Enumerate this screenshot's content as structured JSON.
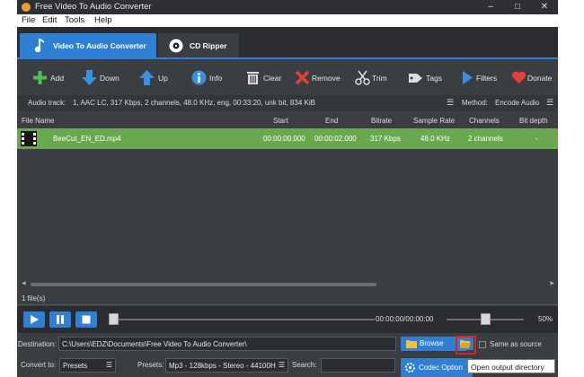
{
  "window": {
    "title": "Free Video To Audio Converter",
    "controls": [
      "–",
      "□",
      "✕"
    ]
  },
  "menu": [
    "File",
    "Edit",
    "Tools",
    "Help"
  ],
  "tabs": [
    {
      "label": "Video To Audio Converter",
      "icon": "music-note-icon",
      "active": true
    },
    {
      "label": "CD Ripper",
      "icon": "cd-icon",
      "active": false
    }
  ],
  "toolbar": {
    "add": "Add",
    "down": "Down",
    "up": "Up",
    "info": "Info",
    "clear": "Clear",
    "remove": "Remove",
    "trim": "Trim",
    "tags": "Tags",
    "filters": "Filters",
    "donate": "Donate"
  },
  "audio_track": {
    "label": "Audio track:",
    "value": "1, AAC LC, 317 Kbps, 2 channels, 48.0 KHz, eng, 00:33:20, unk bit, 834 KiB",
    "method_label": "Method:",
    "method_value": "Encode Audio"
  },
  "columns": [
    "File Name",
    "Start",
    "End",
    "Bitrate",
    "Sample Rate",
    "Channels",
    "Bit depth"
  ],
  "files": [
    {
      "name": "BeeCut_EN_ED.mp4",
      "start": "00:00:00.000",
      "end": "00:00:02.000",
      "bitrate": "317 Kbps",
      "sample_rate": "48.0 KHz",
      "channels": "2 channels",
      "bit_depth": "-"
    }
  ],
  "files_count": "1 file(s)",
  "player": {
    "time": "00:00:00/00:00:00",
    "volume_percent": 50,
    "volume_text": "50%",
    "seek_position": 0
  },
  "destination": {
    "label": "Destination:",
    "path": "C:\\Users\\EDZ\\Documents\\Free Video To Audio Converter\\",
    "browse_label": "Browse",
    "same_as_source_label": "Same as source"
  },
  "convert": {
    "label": "Convert to:",
    "value": "Presets",
    "presets_label": "Presets:",
    "presets_value": "Mp3 - 128kbps - Stereo - 44100H",
    "search_label": "Search:",
    "codec_button": "Codec Option"
  },
  "tooltip": "Open output directory",
  "colors": {
    "accent": "#2f7fd4",
    "row_selected": "#6aa84f",
    "highlight": "#e02020"
  }
}
